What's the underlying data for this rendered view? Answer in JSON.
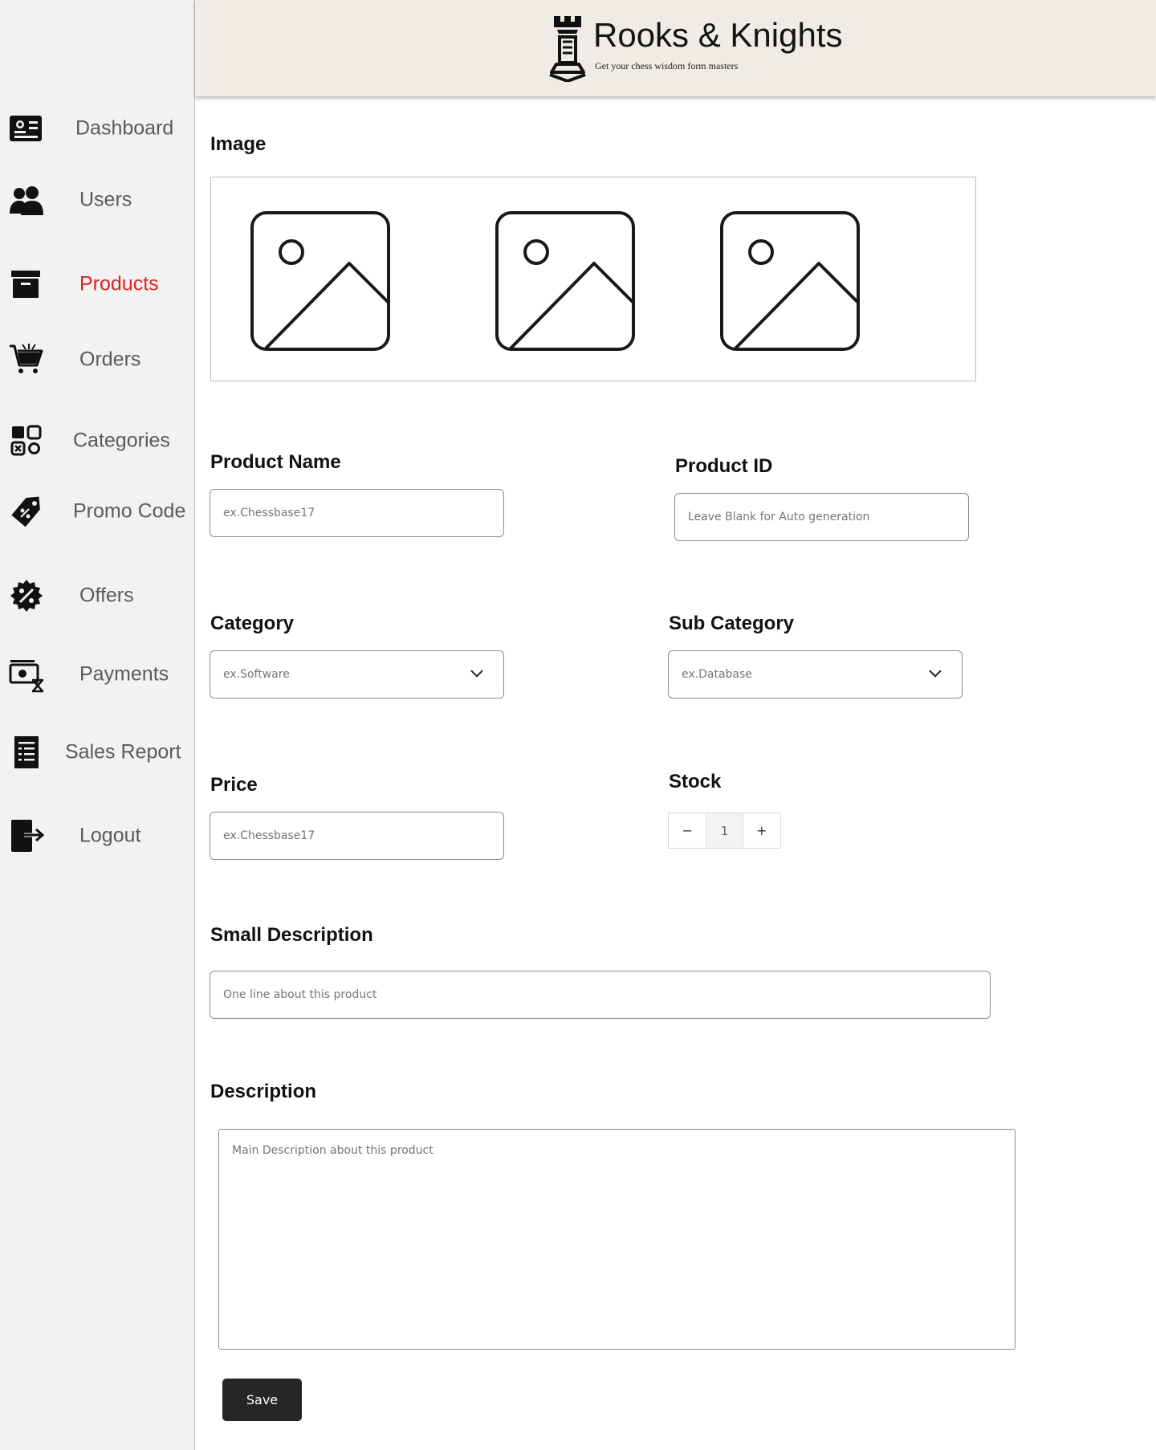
{
  "brand": {
    "name": "Rooks & Knights",
    "tagline": "Get your chess wisdom form masters"
  },
  "sidebar": {
    "active_color": "#e0211c",
    "items": [
      {
        "label": "Dashboard",
        "icon": "dashboard-icon"
      },
      {
        "label": "Users",
        "icon": "users-icon"
      },
      {
        "label": "Products",
        "icon": "archive-box-icon",
        "active": true
      },
      {
        "label": "Orders",
        "icon": "cart-icon"
      },
      {
        "label": "Categories",
        "icon": "categories-grid-icon"
      },
      {
        "label": "Promo Code",
        "icon": "tag-icon"
      },
      {
        "label": "Offers",
        "icon": "discount-badge-icon"
      },
      {
        "label": "Payments",
        "icon": "payment-icon"
      },
      {
        "label": "Sales Report",
        "icon": "report-icon"
      },
      {
        "label": "Logout",
        "icon": "logout-icon"
      }
    ]
  },
  "form": {
    "image_label": "Image",
    "product_name": {
      "label": "Product Name",
      "placeholder": "ex.Chessbase17"
    },
    "product_id": {
      "label": "Product ID",
      "placeholder": "Leave Blank for Auto generation"
    },
    "category": {
      "label": "Category",
      "value": "ex.Software"
    },
    "sub_category": {
      "label": "Sub Category",
      "value": "ex.Database"
    },
    "price": {
      "label": "Price",
      "placeholder": "ex.Chessbase17"
    },
    "stock": {
      "label": "Stock",
      "minus": "−",
      "value": "1",
      "plus": "+"
    },
    "small_description": {
      "label": "Small Description",
      "placeholder": "One line about this product"
    },
    "description": {
      "label": "Description",
      "placeholder": "Main Description about this product"
    },
    "save_label": "Save"
  }
}
